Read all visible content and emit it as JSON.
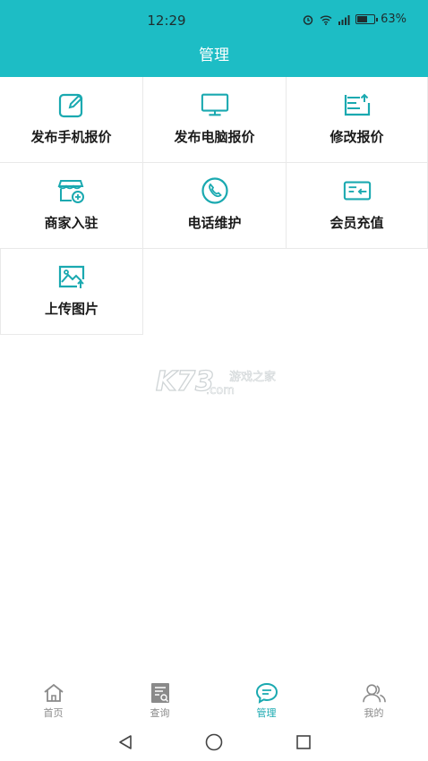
{
  "status_bar": {
    "time": "12:29",
    "battery": "63%",
    "battery_level": 0.63
  },
  "header": {
    "title": "管理"
  },
  "grid": {
    "items": [
      {
        "label": "发布手机报价",
        "icon": "edit-pad-icon"
      },
      {
        "label": "发布电脑报价",
        "icon": "monitor-icon"
      },
      {
        "label": "修改报价",
        "icon": "document-upload-icon"
      },
      {
        "label": "商家入驻",
        "icon": "storefront-add-icon"
      },
      {
        "label": "电话维护",
        "icon": "phone-icon"
      },
      {
        "label": "会员充值",
        "icon": "card-recharge-icon"
      },
      {
        "label": "上传图片",
        "icon": "image-upload-icon"
      }
    ]
  },
  "watermark": {
    "text": "K73 游戏之家 .com"
  },
  "tabbar": {
    "tabs": [
      {
        "label": "首页",
        "icon": "home-icon"
      },
      {
        "label": "查询",
        "icon": "search-doc-icon"
      },
      {
        "label": "管理",
        "icon": "chat-manage-icon"
      },
      {
        "label": "我的",
        "icon": "user-icon"
      }
    ],
    "active": "管理"
  },
  "colors": {
    "accent": "#1dbdc5",
    "icon": "#1aa9b0",
    "inactive": "#8a8a8a"
  }
}
